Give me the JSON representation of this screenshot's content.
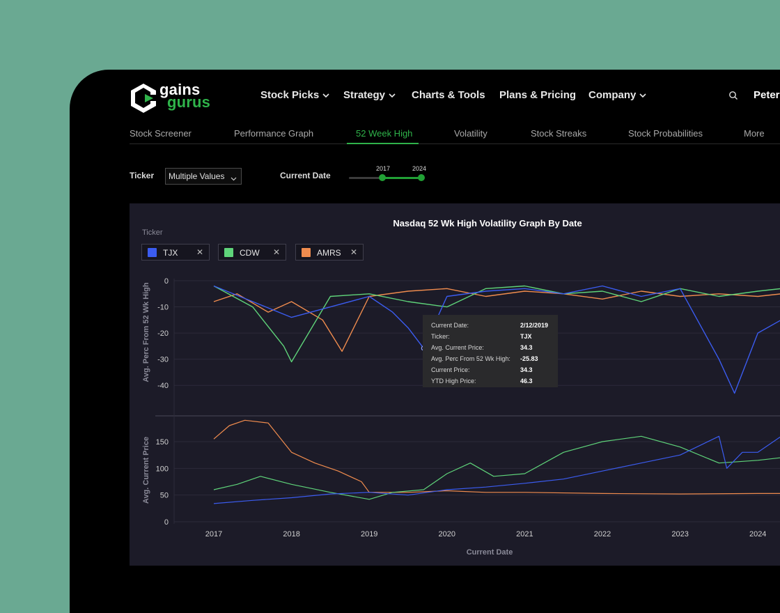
{
  "brand": {
    "line1": "gains",
    "line2": "gurus",
    "colors": {
      "green": "#2fb34a",
      "white": "#ffffff"
    }
  },
  "nav": {
    "items": [
      {
        "label": "Stock Picks",
        "dropdown": true
      },
      {
        "label": "Strategy",
        "dropdown": true
      },
      {
        "label": "Charts & Tools",
        "dropdown": false
      },
      {
        "label": "Plans & Pricing",
        "dropdown": false
      },
      {
        "label": "Company",
        "dropdown": true
      }
    ],
    "search_icon": "search-icon",
    "user": "Peter"
  },
  "subnav": {
    "items": [
      "Stock Screener",
      "Performance Graph",
      "52 Week High",
      "Volatility",
      "Stock Streaks",
      "Stock Probabilities",
      "More"
    ],
    "active": "52 Week High"
  },
  "filters": {
    "ticker_label": "Ticker",
    "ticker_value": "Multiple Values",
    "date_label": "Current Date",
    "date_min": "2017",
    "date_max": "2024"
  },
  "legend": {
    "label": "Ticker",
    "chips": [
      {
        "name": "TJX",
        "color": "#3b5cf0"
      },
      {
        "name": "CDW",
        "color": "#5fd47a"
      },
      {
        "name": "AMRS",
        "color": "#f08c4e"
      }
    ],
    "remove_glyph": "✕"
  },
  "tooltip": {
    "rows": [
      {
        "label": "Current Date:",
        "value": "2/12/2019"
      },
      {
        "label": "Ticker:",
        "value": "TJX"
      },
      {
        "label": "Avg. Current Price:",
        "value": "34.3"
      },
      {
        "label": "Avg. Perc From 52 Wk High:",
        "value": "-25.83"
      },
      {
        "label": "Current Price:",
        "value": "34.3"
      },
      {
        "label": "YTD High Price:",
        "value": "46.3"
      }
    ]
  },
  "chart_data": [
    {
      "type": "line",
      "title": "Nasdaq 52 Wk High Volatility Graph By Date",
      "ylabel": "Avg. Perc From 52 Wk High",
      "ylim": [
        -45,
        0
      ],
      "yticks": [
        0,
        -10,
        -20,
        -30,
        -40
      ],
      "grid": true,
      "series": [
        {
          "name": "TJX",
          "color": "#3b5cf0",
          "x": [
            2017.0,
            2017.5,
            2018.0,
            2018.5,
            2019.0,
            2019.3,
            2019.5,
            2019.7,
            2020.0,
            2020.5,
            2021.0,
            2021.5,
            2022.0,
            2022.5,
            2023.0,
            2023.5,
            2023.7,
            2024.0,
            2024.3
          ],
          "values": [
            -2,
            -8,
            -14,
            -10,
            -6,
            -12,
            -18,
            -25.8,
            -6,
            -4,
            -3,
            -5,
            -2,
            -6,
            -3,
            -30,
            -43,
            -20,
            -15
          ]
        },
        {
          "name": "CDW",
          "color": "#5fd47a",
          "x": [
            2017.0,
            2017.5,
            2017.9,
            2018.0,
            2018.5,
            2019.0,
            2019.5,
            2020.0,
            2020.5,
            2021.0,
            2021.5,
            2022.0,
            2022.5,
            2023.0,
            2023.5,
            2024.0,
            2024.3
          ],
          "values": [
            -2,
            -10,
            -25,
            -31,
            -6,
            -5,
            -8,
            -10,
            -3,
            -2,
            -5,
            -4,
            -8,
            -3,
            -6,
            -4,
            -3
          ]
        },
        {
          "name": "AMRS",
          "color": "#f08c4e",
          "x": [
            2017.0,
            2017.3,
            2017.7,
            2018.0,
            2018.4,
            2018.65,
            2019.0,
            2019.5,
            2020.0,
            2020.5,
            2021.0,
            2021.5,
            2022.0,
            2022.5,
            2023.0,
            2023.5,
            2024.0,
            2024.3
          ],
          "values": [
            -8,
            -5,
            -12,
            -8,
            -15,
            -27,
            -6,
            -4,
            -3,
            -6,
            -4,
            -5,
            -7,
            -4,
            -6,
            -5,
            -6,
            -5
          ]
        }
      ]
    },
    {
      "type": "line",
      "xlabel": "Current Date",
      "ylabel": "Avg. Current Price",
      "ylim": [
        0,
        200
      ],
      "yticks": [
        0,
        50,
        100,
        150
      ],
      "xticks": [
        "2017",
        "2018",
        "2019",
        "2020",
        "2021",
        "2022",
        "2023",
        "2024"
      ],
      "xlim": [
        2017,
        2024.3
      ],
      "grid": true,
      "series": [
        {
          "name": "TJX",
          "color": "#3b5cf0",
          "x": [
            2017.0,
            2017.5,
            2018.0,
            2018.5,
            2019.0,
            2019.5,
            2020.0,
            2020.5,
            2021.0,
            2021.5,
            2022.0,
            2022.5,
            2023.0,
            2023.5,
            2023.6,
            2023.8,
            2024.0,
            2024.3
          ],
          "values": [
            34,
            40,
            45,
            52,
            55,
            50,
            60,
            65,
            72,
            80,
            95,
            110,
            125,
            160,
            100,
            130,
            130,
            160
          ]
        },
        {
          "name": "CDW",
          "color": "#5fd47a",
          "x": [
            2017.0,
            2017.3,
            2017.6,
            2018.0,
            2018.5,
            2019.0,
            2019.3,
            2019.7,
            2020.0,
            2020.3,
            2020.6,
            2021.0,
            2021.5,
            2022.0,
            2022.5,
            2023.0,
            2023.5,
            2024.0,
            2024.3
          ],
          "values": [
            60,
            70,
            85,
            70,
            55,
            42,
            55,
            60,
            90,
            110,
            85,
            90,
            130,
            150,
            160,
            140,
            110,
            115,
            120
          ]
        },
        {
          "name": "AMRS",
          "color": "#f08c4e",
          "x": [
            2017.0,
            2017.2,
            2017.4,
            2017.7,
            2018.0,
            2018.3,
            2018.6,
            2018.9,
            2019.0,
            2019.5,
            2020.0,
            2020.5,
            2021.0,
            2022.0,
            2023.0,
            2024.0,
            2024.3
          ],
          "values": [
            155,
            180,
            190,
            185,
            130,
            110,
            95,
            75,
            55,
            55,
            58,
            55,
            55,
            53,
            52,
            53,
            53
          ]
        }
      ]
    }
  ]
}
